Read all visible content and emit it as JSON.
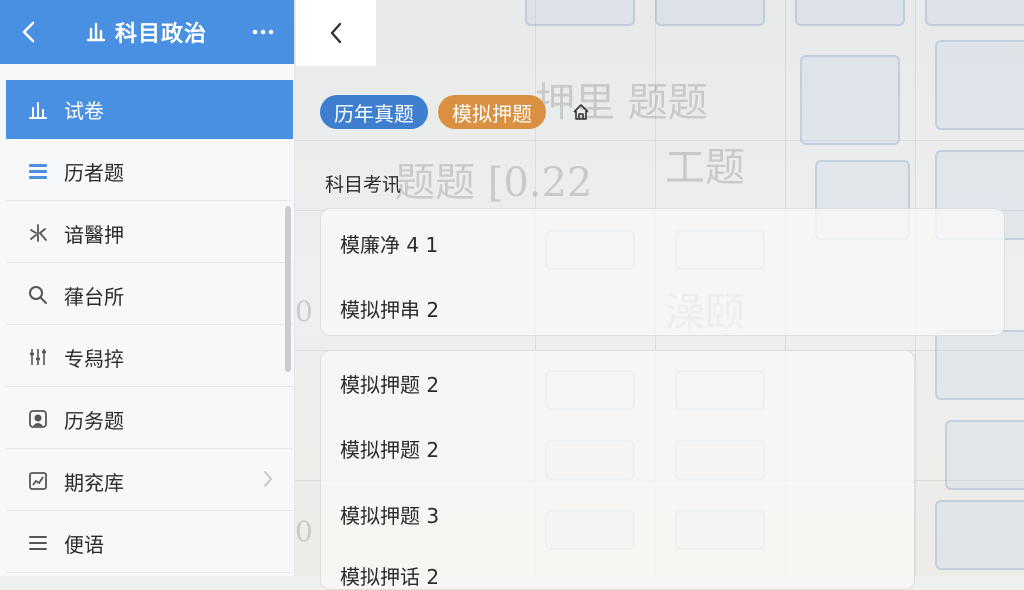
{
  "sidebar": {
    "title": "科目政治",
    "items": [
      {
        "label": "试卷",
        "icon": "bar-chart-icon"
      },
      {
        "label": "历者题",
        "icon": "stack-icon"
      },
      {
        "label": "谙醫押",
        "icon": "water-icon"
      },
      {
        "label": "葎台所",
        "icon": "search-icon"
      },
      {
        "label": "专舄捽",
        "icon": "sliders-icon"
      },
      {
        "label": "历务题",
        "icon": "shield-icon"
      },
      {
        "label": "期兖库",
        "icon": "chart-box-icon"
      },
      {
        "label": "便语",
        "icon": "menu-icon"
      }
    ],
    "active_index": 0,
    "colors": {
      "header": "#4a90e2",
      "active": "#4a90e2"
    }
  },
  "main": {
    "chips": [
      {
        "label": "历年真题",
        "color": "#3e7fcf"
      },
      {
        "label": "模拟押题",
        "color": "#d99040"
      }
    ],
    "filter_icon": "home-icon",
    "section_label": "科目考讯",
    "card1_rows": [
      "模廉净 4 1",
      "模拟押串 2"
    ],
    "card2_rows": [
      "模拟押题 2",
      "模拟押题 2",
      "模拟押题 3",
      "模拟押话 2"
    ]
  }
}
